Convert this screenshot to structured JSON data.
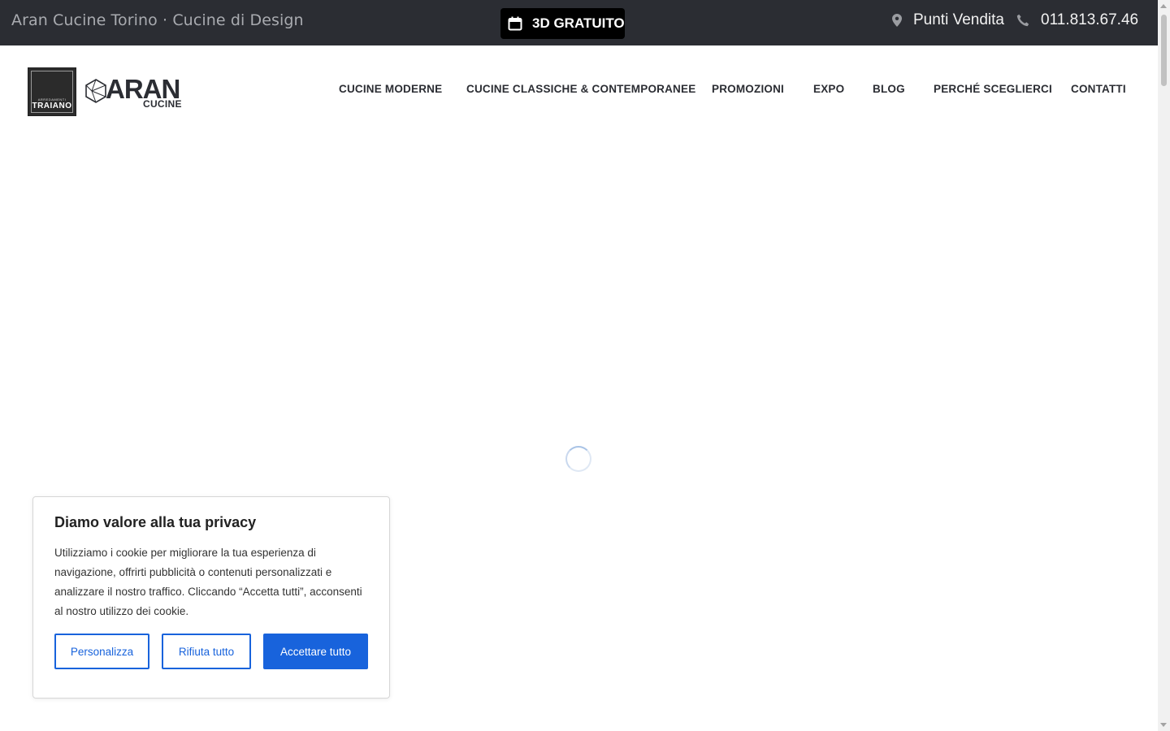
{
  "topbar": {
    "tagline": "Aran Cucine Torino · Cucine di Design",
    "cta_label": "3D GRATUITO",
    "stores_label": "Punti Vendita",
    "phone": "011.813.67.46"
  },
  "header": {
    "logo_traiano_small": "ARREDAMENTI",
    "logo_traiano_name": "TRAIANO",
    "logo_aran_word": "ARAN",
    "logo_aran_sub": "CUCINE",
    "nav": [
      "CUCINE MODERNE",
      "CUCINE CLASSICHE & CONTEMPORANEE",
      "PROMOZIONI",
      "EXPO",
      "BLOG",
      "PERCHÉ SCEGLIERCI",
      "CONTATTI"
    ]
  },
  "cookie": {
    "title": "Diamo valore alla tua privacy",
    "body": "Utilizziamo i cookie per migliorare la tua esperienza di navigazione, offrirti pubblicità o contenuti personalizzati e analizzare il nostro traffico. Cliccando “Accetta tutti”, acconsenti al nostro utilizzo dei cookie.",
    "customize_label": "Personalizza",
    "reject_label": "Rifiuta tutto",
    "accept_label": "Accettare tutto"
  },
  "colors": {
    "topbar_bg": "#2b2d33",
    "accent_blue": "#1863dc",
    "cta_bg": "#000000"
  },
  "icons": {
    "cta": "calendar-icon",
    "stores": "map-pin-icon",
    "phone": "phone-icon"
  }
}
